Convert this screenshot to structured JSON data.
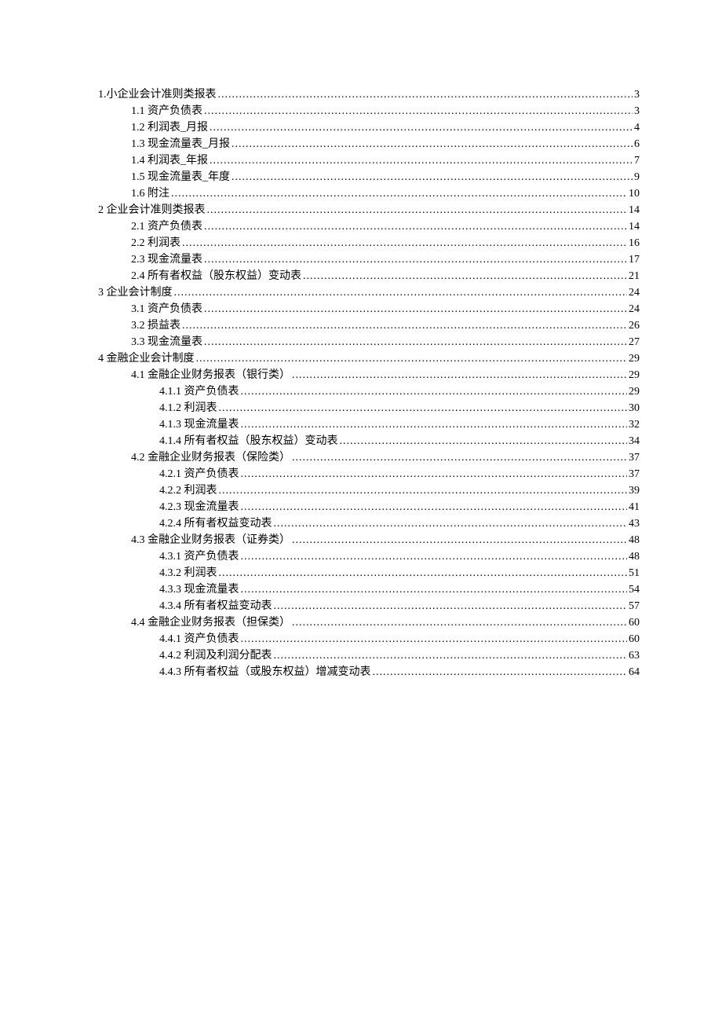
{
  "toc": [
    {
      "level": 0,
      "label": "1.小企业会计准则类报表",
      "page": "3"
    },
    {
      "level": 1,
      "label": "1.1 资产负债表",
      "page": "3"
    },
    {
      "level": 1,
      "label": "1.2 利润表_月报",
      "page": "4"
    },
    {
      "level": 1,
      "label": "1.3 现金流量表_月报",
      "page": "6"
    },
    {
      "level": 1,
      "label": "1.4 利润表_年报",
      "page": "7"
    },
    {
      "level": 1,
      "label": "1.5 现金流量表_年度",
      "page": "9"
    },
    {
      "level": 1,
      "label": "1.6 附注",
      "page": "10"
    },
    {
      "level": 0,
      "label": "2 企业会计准则类报表",
      "page": "14"
    },
    {
      "level": 1,
      "label": "2.1 资产负债表",
      "page": "14"
    },
    {
      "level": 1,
      "label": "2.2 利润表",
      "page": "16"
    },
    {
      "level": 1,
      "label": "2.3 现金流量表",
      "page": "17"
    },
    {
      "level": 1,
      "label": "2.4 所有者权益（股东权益）变动表",
      "page": "21"
    },
    {
      "level": 0,
      "label": "3 企业会计制度",
      "page": "24"
    },
    {
      "level": 1,
      "label": "3.1 资产负债表",
      "page": "24"
    },
    {
      "level": 1,
      "label": "3.2 损益表",
      "page": "26"
    },
    {
      "level": 1,
      "label": "3.3 现金流量表",
      "page": "27"
    },
    {
      "level": 0,
      "label": "4 金融企业会计制度",
      "page": "29"
    },
    {
      "level": 1,
      "label": "4.1 金融企业财务报表（银行类）",
      "page": "29"
    },
    {
      "level": 2,
      "label": "4.1.1 资产负债表",
      "page": "29"
    },
    {
      "level": 2,
      "label": "4.1.2 利润表",
      "page": "30"
    },
    {
      "level": 2,
      "label": "4.1.3 现金流量表",
      "page": "32"
    },
    {
      "level": 2,
      "label": "4.1.4 所有者权益（股东权益）变动表",
      "page": "34"
    },
    {
      "level": 1,
      "label": "4.2 金融企业财务报表（保险类）",
      "page": "37"
    },
    {
      "level": 2,
      "label": "4.2.1 资产负债表",
      "page": "37"
    },
    {
      "level": 2,
      "label": "4.2.2 利润表",
      "page": "39"
    },
    {
      "level": 2,
      "label": "4.2.3 现金流量表",
      "page": "41"
    },
    {
      "level": 2,
      "label": "4.2.4 所有者权益变动表",
      "page": "43"
    },
    {
      "level": 1,
      "label": "4.3 金融企业财务报表（证券类）",
      "page": "48"
    },
    {
      "level": 2,
      "label": "4.3.1 资产负债表",
      "page": "48"
    },
    {
      "level": 2,
      "label": "4.3.2 利润表",
      "page": "51"
    },
    {
      "level": 2,
      "label": "4.3.3 现金流量表",
      "page": "54"
    },
    {
      "level": 2,
      "label": "4.3.4 所有者权益变动表",
      "page": "57"
    },
    {
      "level": 1,
      "label": "4.4 金融企业财务报表（担保类）",
      "page": "60"
    },
    {
      "level": 2,
      "label": "4.4.1 资产负债表",
      "page": "60"
    },
    {
      "level": 2,
      "label": "4.4.2 利润及利润分配表",
      "page": "63"
    },
    {
      "level": 2,
      "label": "4.4.3 所有者权益（或股东权益）增减变动表",
      "page": "64"
    }
  ]
}
